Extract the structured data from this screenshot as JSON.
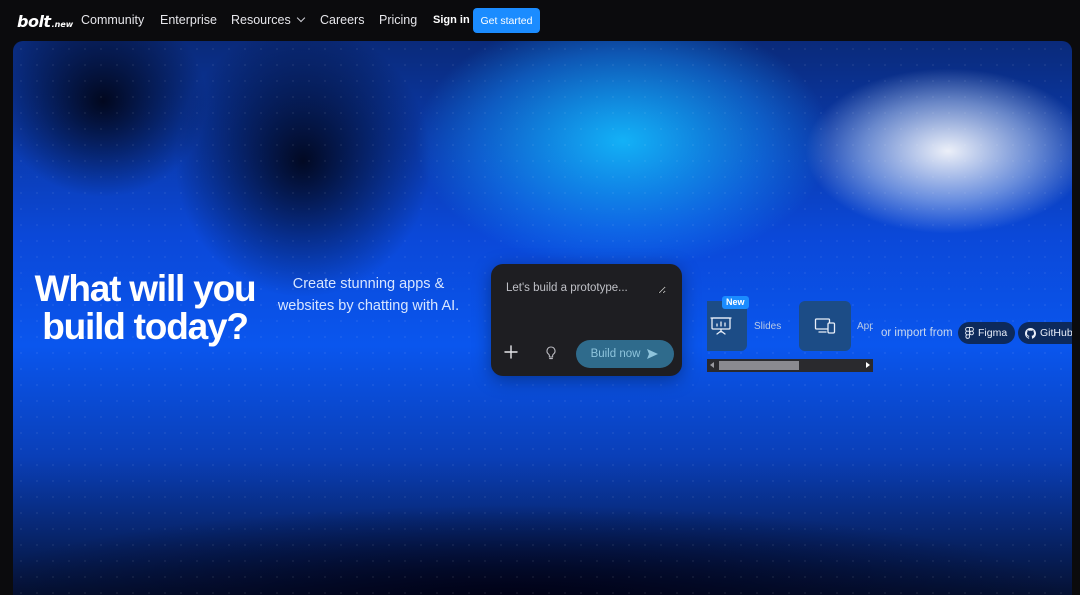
{
  "nav": {
    "logo": "bolt",
    "logo_suffix": ".new",
    "links": [
      "Community",
      "Enterprise",
      "Resources",
      "Careers",
      "Pricing"
    ],
    "sign_in": "Sign in",
    "get_started": "Get started"
  },
  "hero": {
    "headline": "What will you build today?",
    "subline": "Create stunning apps & websites by chatting with AI."
  },
  "prompt": {
    "placeholder": "Let's build a prototype...",
    "build_button": "Build now"
  },
  "templates": {
    "badge": "New",
    "items": [
      "Slides",
      "App"
    ]
  },
  "import": {
    "label": "or import from",
    "figma": "Figma",
    "github": "GitHub"
  },
  "colors": {
    "accent": "#1b8cff",
    "build_button_bg": "#2f6b8c",
    "prompt_bg": "#1e1e22"
  }
}
